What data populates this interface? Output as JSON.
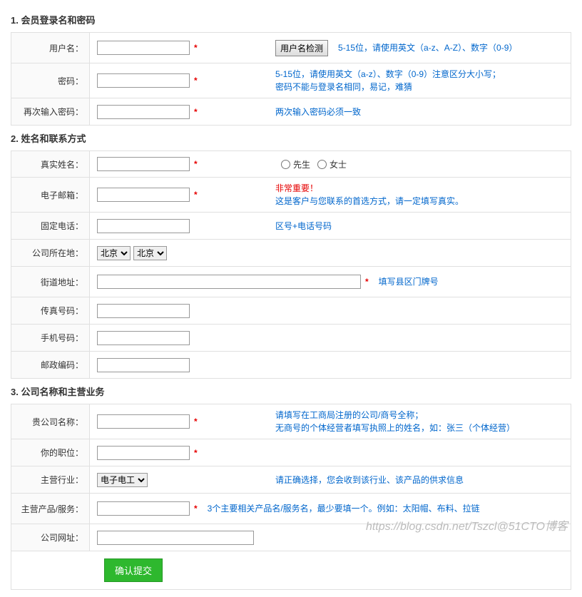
{
  "section1": {
    "title": "1. 会员登录名和密码",
    "username": {
      "label": "用户名：",
      "btn": "用户名检测",
      "hint": "5-15位，请使用英文（a-z、A-Z）、数字（0-9）"
    },
    "password": {
      "label": "密码：",
      "hint1": "5-15位，请使用英文（a-z）、数字（0-9）注意区分大小写；",
      "hint2": "密码不能与登录名相同，易记，难猜"
    },
    "password2": {
      "label": "再次输入密码：",
      "hint": "两次输入密码必须一致"
    }
  },
  "section2": {
    "title": "2. 姓名和联系方式",
    "realname": {
      "label": "真实姓名：",
      "radio1": "先生",
      "radio2": "女士"
    },
    "email": {
      "label": "电子邮箱：",
      "hint_red": "非常重要！",
      "hint": "这是客户与您联系的首选方式，请一定填写真实。"
    },
    "phone": {
      "label": "固定电话：",
      "hint": "区号+电话号码"
    },
    "company_loc": {
      "label": "公司所在地：",
      "opt1": "北京",
      "opt2": "北京"
    },
    "street": {
      "label": "街道地址：",
      "hint": "填写县区门牌号"
    },
    "fax": {
      "label": "传真号码："
    },
    "mobile": {
      "label": "手机号码："
    },
    "postal": {
      "label": "邮政编码："
    }
  },
  "section3": {
    "title": "3. 公司名称和主营业务",
    "company_name": {
      "label": "贵公司名称：",
      "hint": "请填写在工商局注册的公司/商号全称；",
      "hint2": "无商号的个体经营者填写执照上的姓名，如：张三（个体经营）"
    },
    "position": {
      "label": "你的职位："
    },
    "industry": {
      "label": "主营行业：",
      "opt": "电子电工",
      "hint": "请正确选择，您会收到该行业、该产品的供求信息"
    },
    "products": {
      "label": "主营产品/服务：",
      "hint": "3个主要相关产品名/服务名，最少要填一个。例如：太阳帽、布料、拉链"
    },
    "website": {
      "label": "公司网址："
    }
  },
  "submit": "确认提交",
  "watermark": "https://blog.csdn.net/Tszcl@51CTO博客"
}
